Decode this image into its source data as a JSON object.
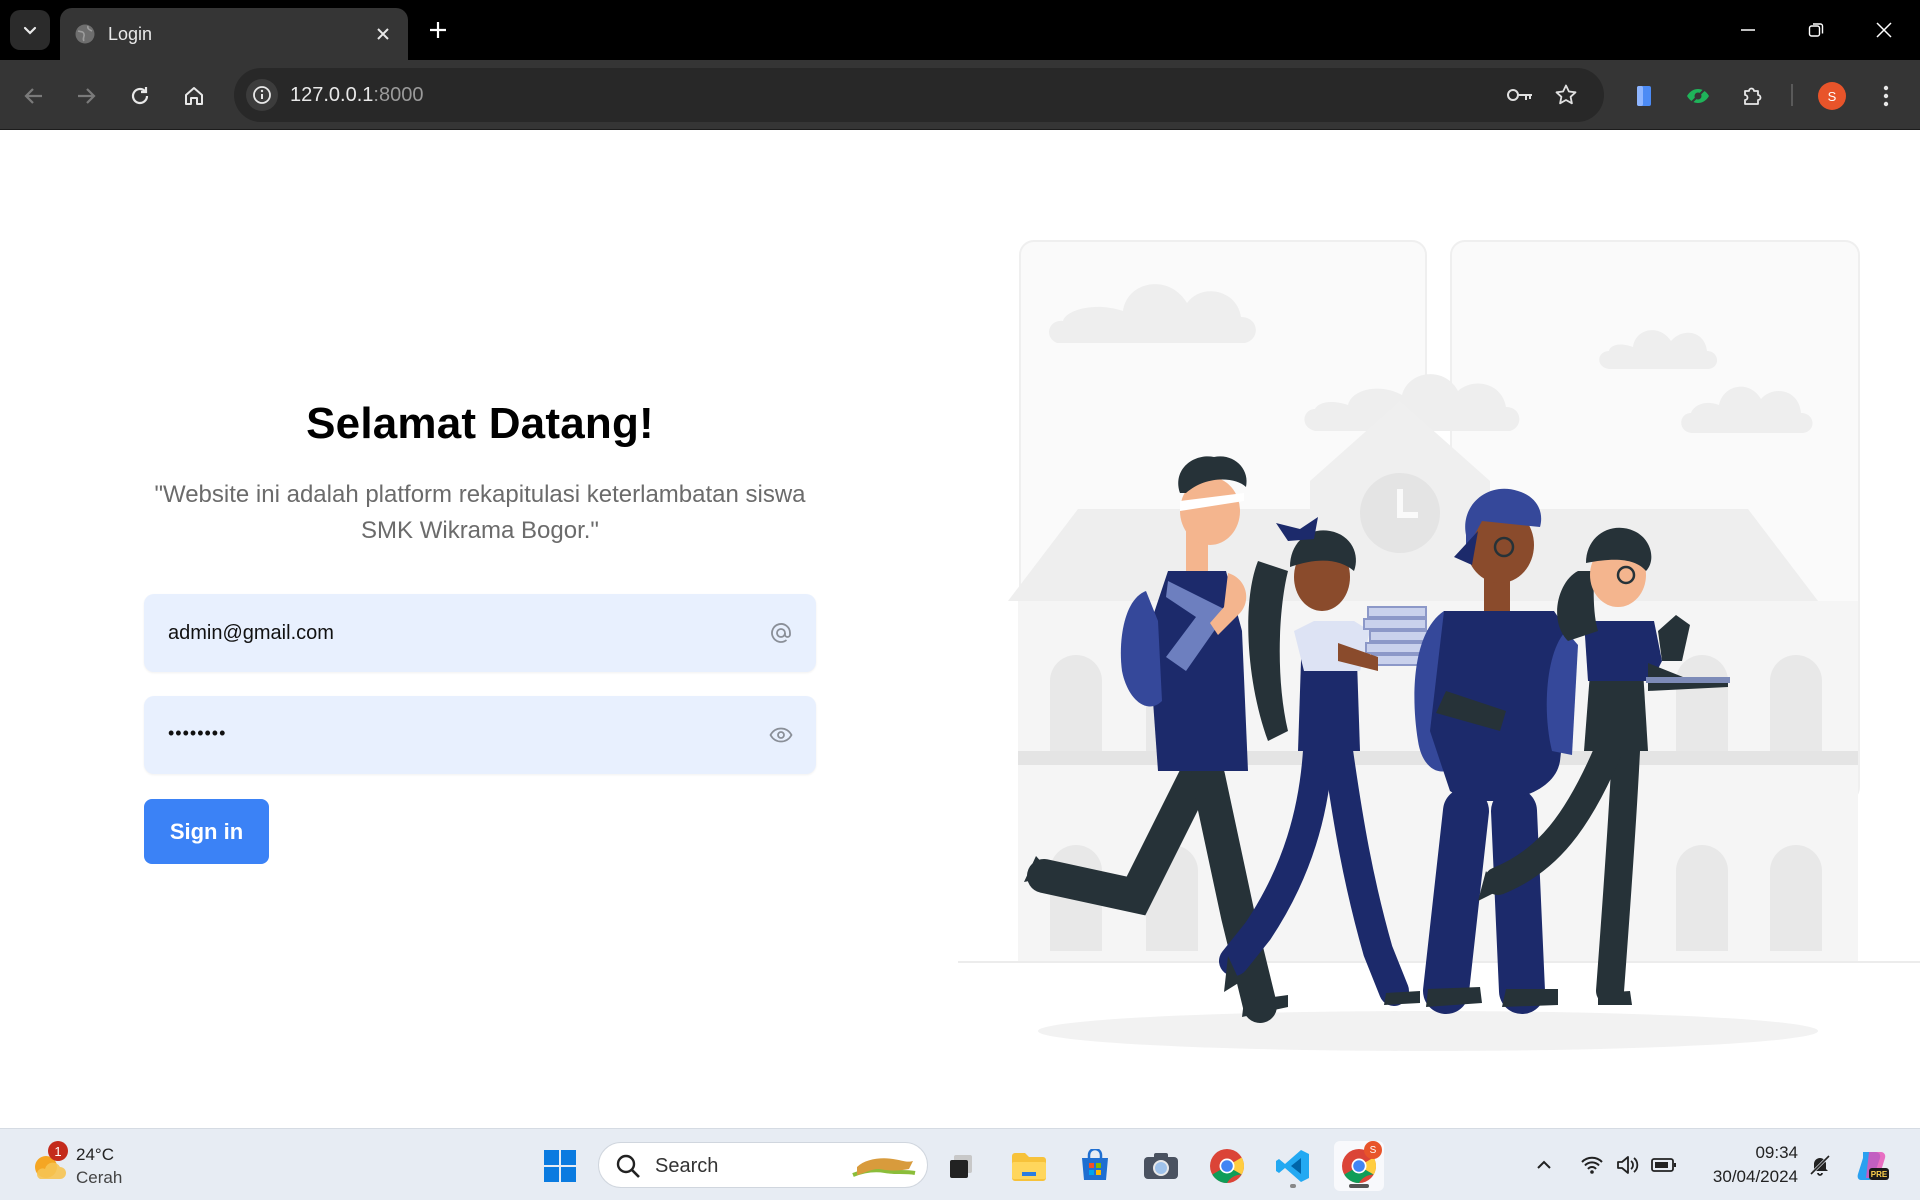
{
  "browser": {
    "tab_title": "Login",
    "url_host": "127.0.0.1",
    "url_port": ":8000",
    "profile_initial": "S"
  },
  "page": {
    "heading": "Selamat Datang!",
    "subtitle": "\"Website ini adalah platform rekapitulasi keterlambatan siswa SMK Wikrama Bogor.\"",
    "email_value": "admin@gmail.com",
    "password_mask": "••••••••",
    "signin_label": "Sign in"
  },
  "taskbar": {
    "weather_temp": "24°C",
    "weather_cond": "Cerah",
    "weather_badge": "1",
    "search_label": "Search",
    "time": "09:34",
    "date": "30/04/2024",
    "chrome_badge": "S"
  },
  "colors": {
    "primary_button": "#3b82f6",
    "input_bg": "#e8f0fe",
    "illustration_navy": "#1c2a6b"
  },
  "icons": [
    "chevron-down-icon",
    "globe-icon",
    "close-icon",
    "plus-icon",
    "minimize-icon",
    "restore-icon",
    "back-icon",
    "forward-icon",
    "reload-icon",
    "home-icon",
    "info-icon",
    "key-icon",
    "star-icon",
    "extension-icon",
    "menu-icon",
    "at-icon",
    "eye-icon",
    "windows-icon",
    "search-icon",
    "chrome-icon",
    "vscode-icon"
  ]
}
